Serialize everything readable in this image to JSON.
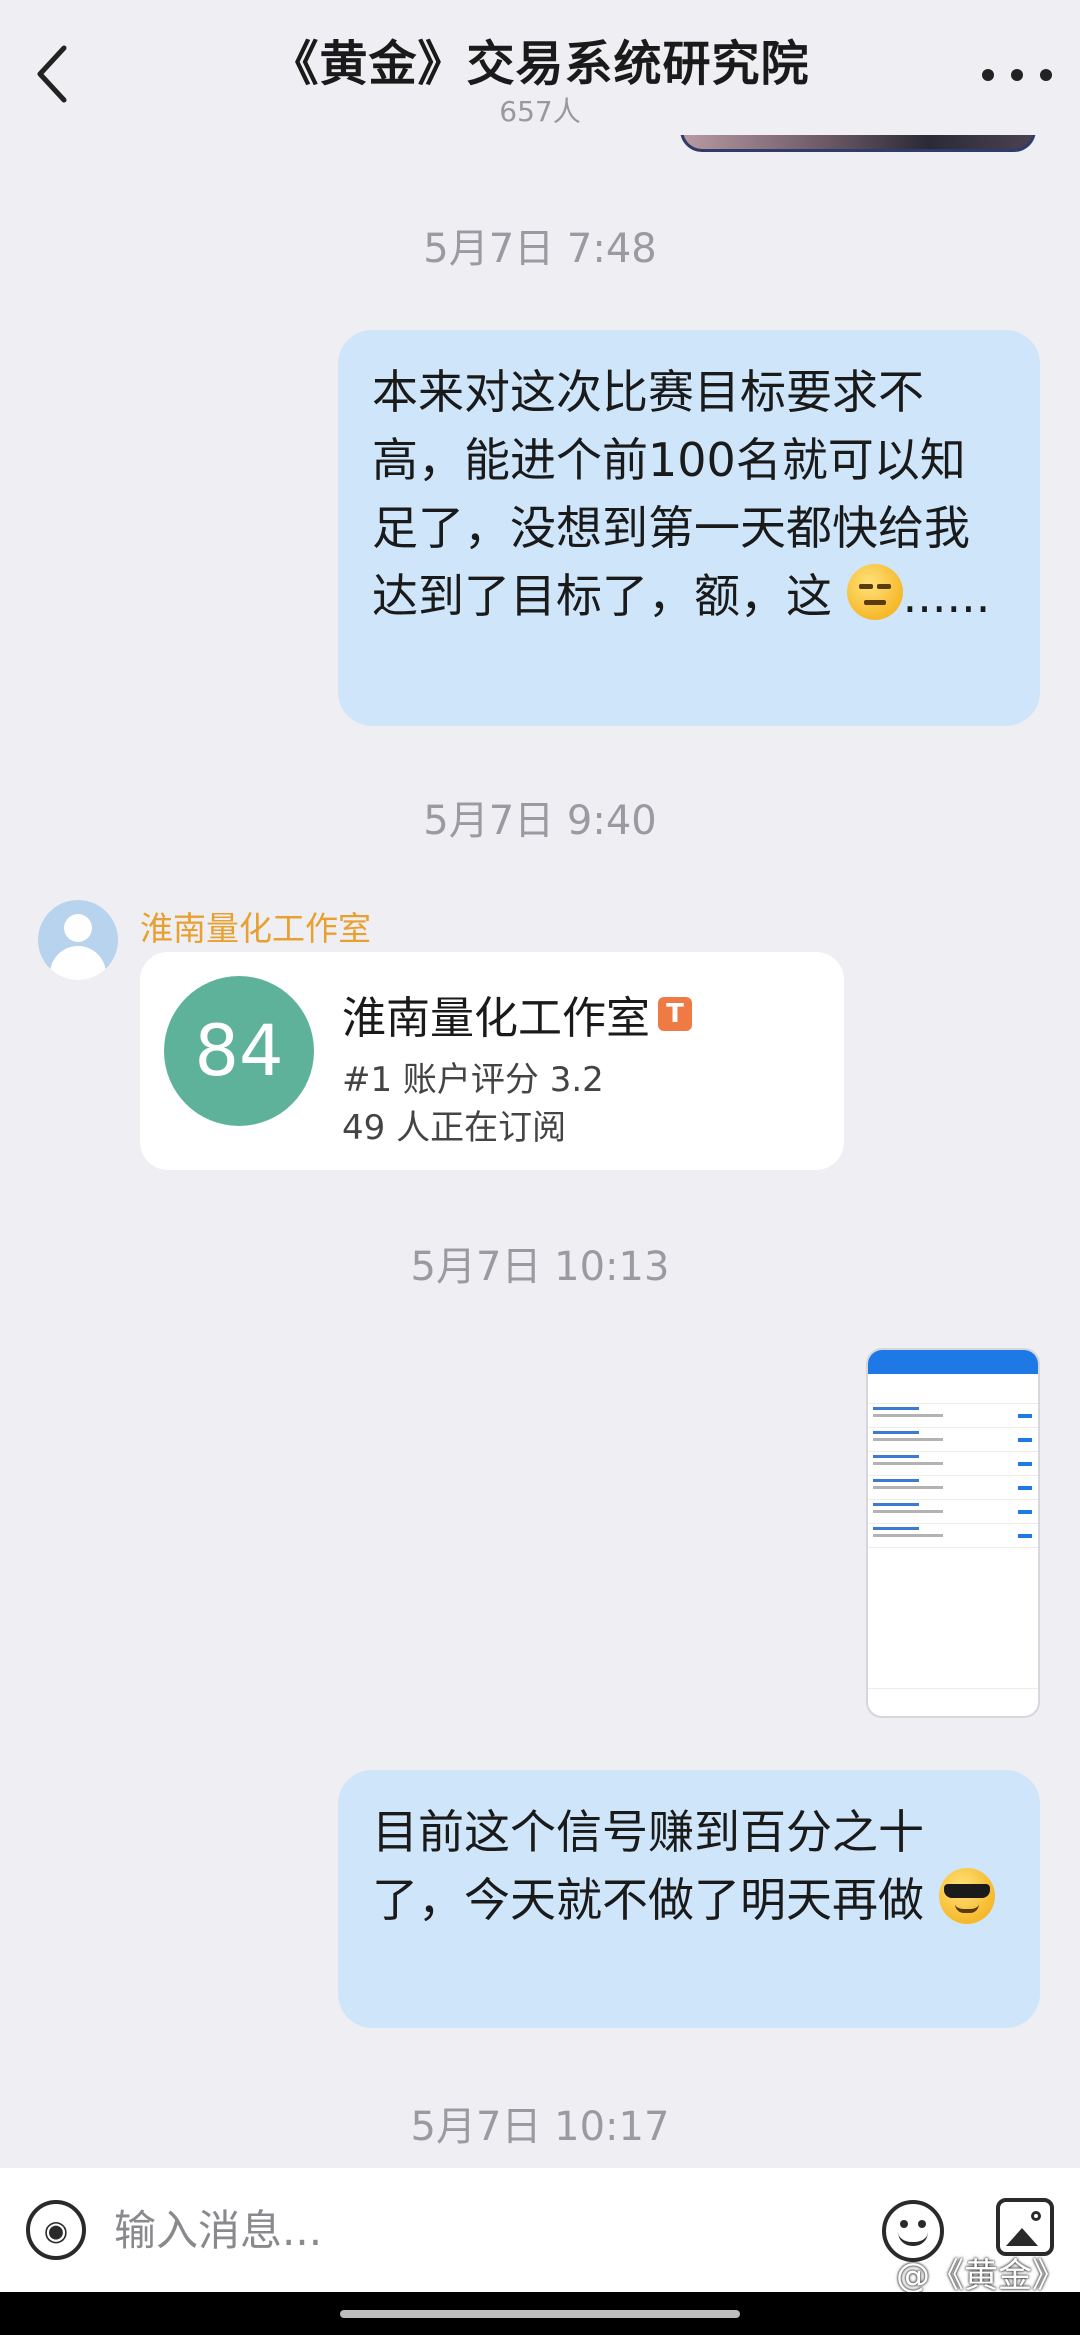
{
  "header": {
    "title": "《黄金》交易系统研究院",
    "member_count": "657人"
  },
  "messages": [
    {
      "timestamp": "5月7日 7:48"
    },
    {
      "text": "本来对这次比赛目标要求不高，能进个前100名就可以知足了，没想到第一天都快给我达到了目标了，额，这",
      "tail": "......",
      "emoji": "neutral-face"
    },
    {
      "timestamp": "5月7日 9:40"
    },
    {
      "sender": "淮南量化工作室",
      "card": {
        "score": "84",
        "name": "淮南量化工作室",
        "badge": "T",
        "rank_line": "#1 账户评分 3.2",
        "subscribers_line": "49 人正在订阅"
      }
    },
    {
      "timestamp": "5月7日 10:13"
    },
    {
      "text": "目前这个信号赚到百分之十了，今天就不做了明天再做",
      "emoji": "cool-face"
    },
    {
      "timestamp": "5月7日 10:17"
    }
  ],
  "input": {
    "placeholder": "输入消息..."
  },
  "watermark": "@《黄金》",
  "colors": {
    "background": "#efeff3",
    "outgoing_bubble": "#cfe6fa",
    "score_circle": "#5fb29a",
    "sender_name": "#e8a030",
    "badge": "#f07a44"
  },
  "icons": [
    "back-arrow-icon",
    "more-icon",
    "voice-icon",
    "emoji-icon",
    "image-icon"
  ]
}
